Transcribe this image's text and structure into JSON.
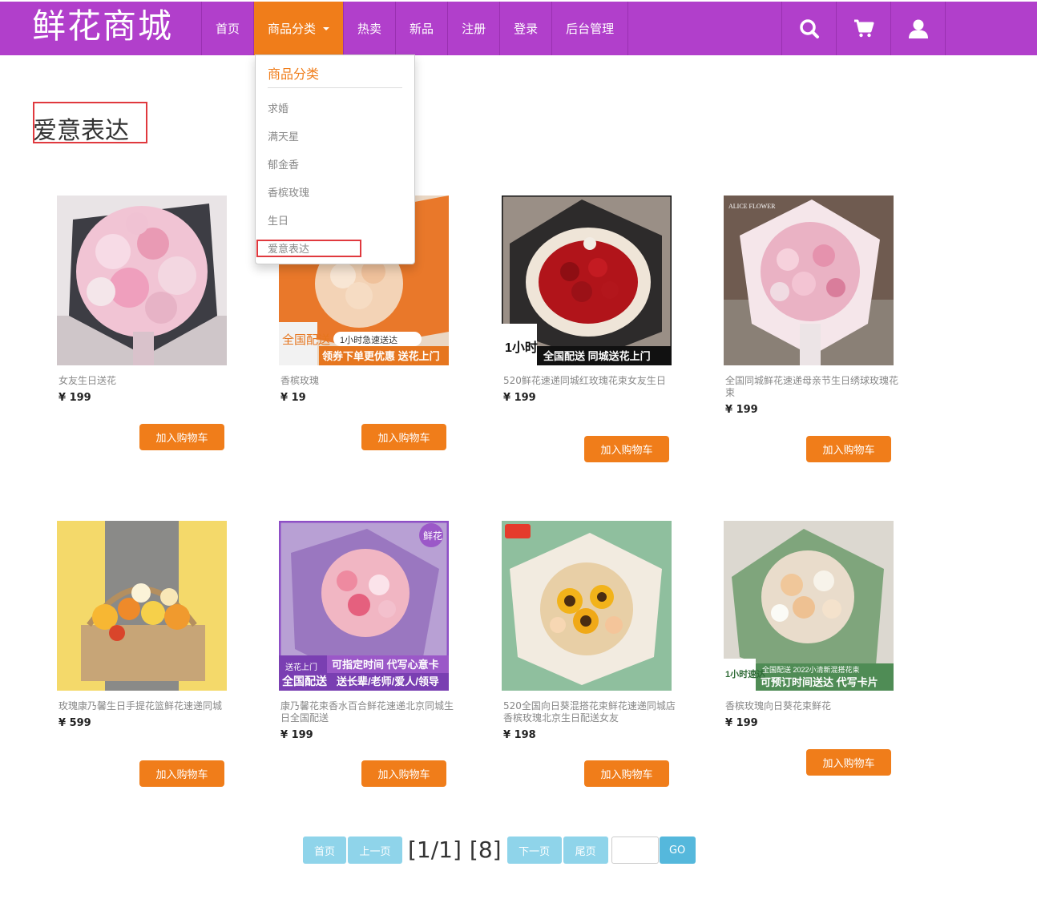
{
  "brand": "鲜花商城",
  "nav": {
    "items": [
      "首页",
      "商品分类",
      "热卖",
      "新品",
      "注册",
      "登录",
      "后台管理"
    ],
    "icons": [
      "search-icon",
      "cart-icon",
      "user-icon"
    ]
  },
  "dropdown": {
    "header": "商品分类",
    "items": [
      "求婚",
      "满天星",
      "郁金香",
      "香槟玫瑰",
      "生日",
      "爱意表达"
    ]
  },
  "page_title": "爱意表达",
  "products": [
    {
      "name": "女友生日送花",
      "price": "¥ 199",
      "button": "加入购物车"
    },
    {
      "name": "香槟玫瑰",
      "price": "¥ 19",
      "button": "加入购物车"
    },
    {
      "name": "520鲜花速递同城红玫瑰花束女友生日",
      "price": "¥ 199",
      "button": "加入购物车"
    },
    {
      "name": "全国同城鲜花速递母亲节生日绣球玫瑰花束",
      "price": "¥ 199",
      "button": "加入购物车"
    },
    {
      "name": "玫瑰康乃馨生日手提花篮鲜花速递同城",
      "price": "¥ 599",
      "button": "加入购物车"
    },
    {
      "name": "康乃馨花束香水百合鲜花速递北京同城生日全国配送",
      "price": "¥ 199",
      "button": "加入购物车"
    },
    {
      "name": "520全国向日葵混搭花束鲜花速递同城店香槟玫瑰北京生日配送女友",
      "price": "¥ 198",
      "button": "加入购物车"
    },
    {
      "name": "香槟玫瑰向日葵花束鲜花",
      "price": "¥ 199",
      "button": "加入购物车"
    }
  ],
  "image_overlays": {
    "p2_badge": "全国配送",
    "p2_banner": "领券下单更优惠 送花上门",
    "p2_tag": "1小时急速送达",
    "p3_badge": "1小时",
    "p3_banner": "全国配送 同城送花上门",
    "p4_logo": "ALICE FLOWER",
    "p6_corner": "鲜花",
    "p6_tag": "送花上门",
    "p6_badge": "全国配送",
    "p6_line1": "可指定时间 代写心意卡",
    "p6_line2": "送长辈/老师/爱人/领导",
    "p8_badge": "1小时速达",
    "p8_line1": "全国配送 2022小清新混搭花束",
    "p8_line2": "可预订时间送达 代写卡片"
  },
  "pagination": {
    "first": "首页",
    "prev": "上一页",
    "page_info": "[1/1]",
    "total": "[8]",
    "next": "下一页",
    "last": "尾页",
    "go": "GO"
  },
  "colors": {
    "navbar": "#b13fcb",
    "accent": "#f07d1a",
    "pager": "#8fd4ea",
    "highlight_box": "#e0393e"
  }
}
